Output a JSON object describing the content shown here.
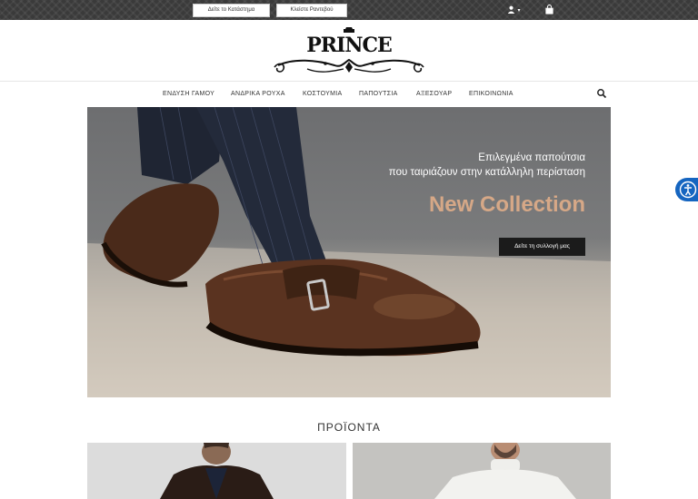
{
  "topbar": {
    "catalog_button": "Δείτε το Κατάστημα",
    "appointment_button": "Κλείστε Ραντεβού",
    "user_caret": "▾"
  },
  "nav": {
    "items": [
      "ΕΝΔΥΣΗ ΓΑΜΟΥ",
      "ΑΝΔΡΙΚΑ ΡΟΥΧΑ",
      "ΚΟΣΤΟΥΜΙΑ",
      "ΠΑΠΟΥΤΣΙΑ",
      "ΑΞΕΣΟΥΑΡ",
      "ΕΠΙΚΟΙΝΩΝΙΑ"
    ]
  },
  "logo": {
    "text": "PRINCE"
  },
  "hero": {
    "line1": "Επιλεγμένα παπούτσια",
    "line2": "που ταιριάζουν στην κατάλληλη περίσταση",
    "title": "New Collection",
    "button": "Δείτε τη συλλογή μας",
    "title_color": "#d6a887"
  },
  "products": {
    "title": "ΠΡΟΪΟΝΤΑ"
  },
  "colors": {
    "topbar": "#3a3a3a",
    "accessibility": "#1565c0"
  }
}
